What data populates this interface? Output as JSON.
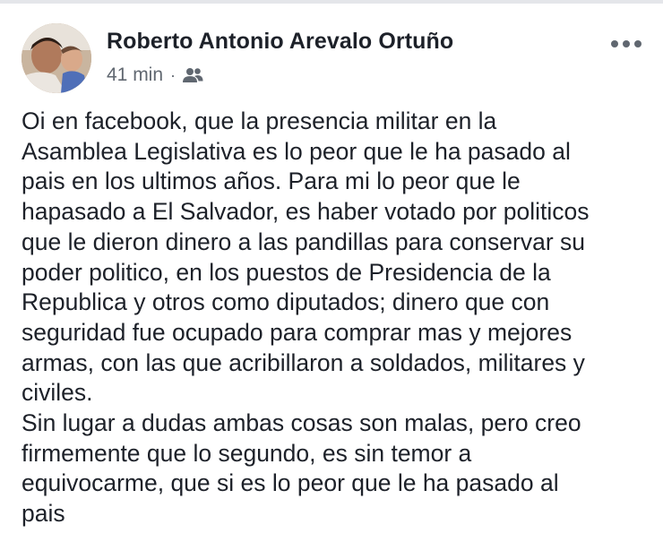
{
  "post": {
    "author": "Roberto Antonio Arevalo Ortuño",
    "time": "41 min",
    "separator": "·",
    "audience_icon": "friends-icon",
    "more_icon": "more-options-icon",
    "paragraphs": [
      "Oi en facebook, que la presencia militar en la\nAsamblea Legislativa es lo peor que le ha pasado al\npais en los ultimos años. Para mi lo peor que le\nhapasado a El Salvador, es haber votado por politicos\nque le dieron dinero a las pandillas para conservar su\npoder politico, en los puestos de Presidencia de la\nRepublica y otros como diputados; dinero que con\nseguridad fue ocupado para comprar mas y mejores\narmas, con las que acribillaron a soldados, militares y\nciviles.",
      "Sin lugar a dudas ambas cosas son malas, pero creo\nfirmemente que lo segundo, es sin temor a\nequivocarme, que si es lo peor que le ha pasado al\npais"
    ]
  },
  "colors": {
    "text": "#1d2129",
    "meta": "#606770",
    "background": "#ffffff",
    "border": "#e4e6ea"
  }
}
